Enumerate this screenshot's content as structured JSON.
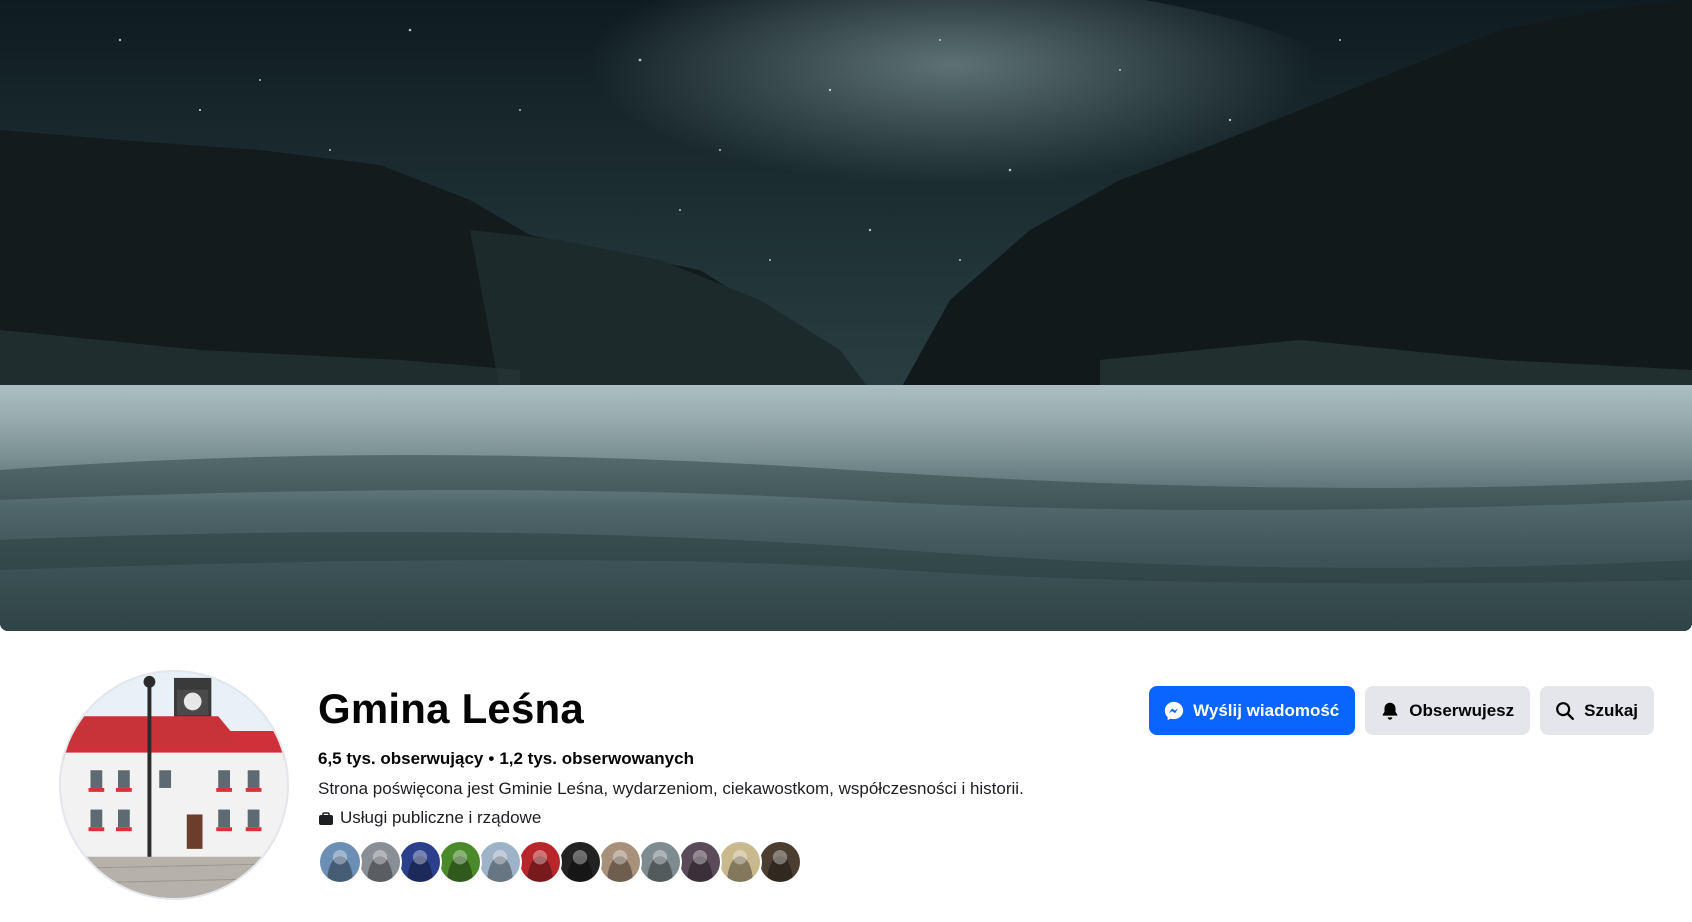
{
  "page": {
    "name": "Gmina Leśna",
    "stats": {
      "followers": "6,5 tys. obserwujący",
      "separator": "•",
      "following": "1,2 tys. obserwowanych"
    },
    "description": "Strona poświęcona jest Gminie Leśna, wydarzeniom, ciekawostkom, współczesności i historii.",
    "category": "Usługi publiczne i rządowe"
  },
  "actions": {
    "message": {
      "label": "Wyślij wiadomość",
      "icon": "messenger-icon"
    },
    "following": {
      "label": "Obserwujesz",
      "icon": "bell-icon"
    },
    "search": {
      "label": "Szukaj",
      "icon": "search-icon"
    }
  },
  "colors": {
    "primary": "#0866ff",
    "secondary_button": "#e4e6eb",
    "text": "#050505"
  },
  "follower_avatars": [
    {
      "color": "#6b8fb5"
    },
    {
      "color": "#8a8f96"
    },
    {
      "color": "#2b3f8a"
    },
    {
      "color": "#4a8a2a"
    },
    {
      "color": "#9fb3c8"
    },
    {
      "color": "#b8262b"
    },
    {
      "color": "#222222"
    },
    {
      "color": "#a8917a"
    },
    {
      "color": "#7f8c8f"
    },
    {
      "color": "#5b4a58"
    },
    {
      "color": "#c9b98e"
    },
    {
      "color": "#4b3d30"
    }
  ]
}
